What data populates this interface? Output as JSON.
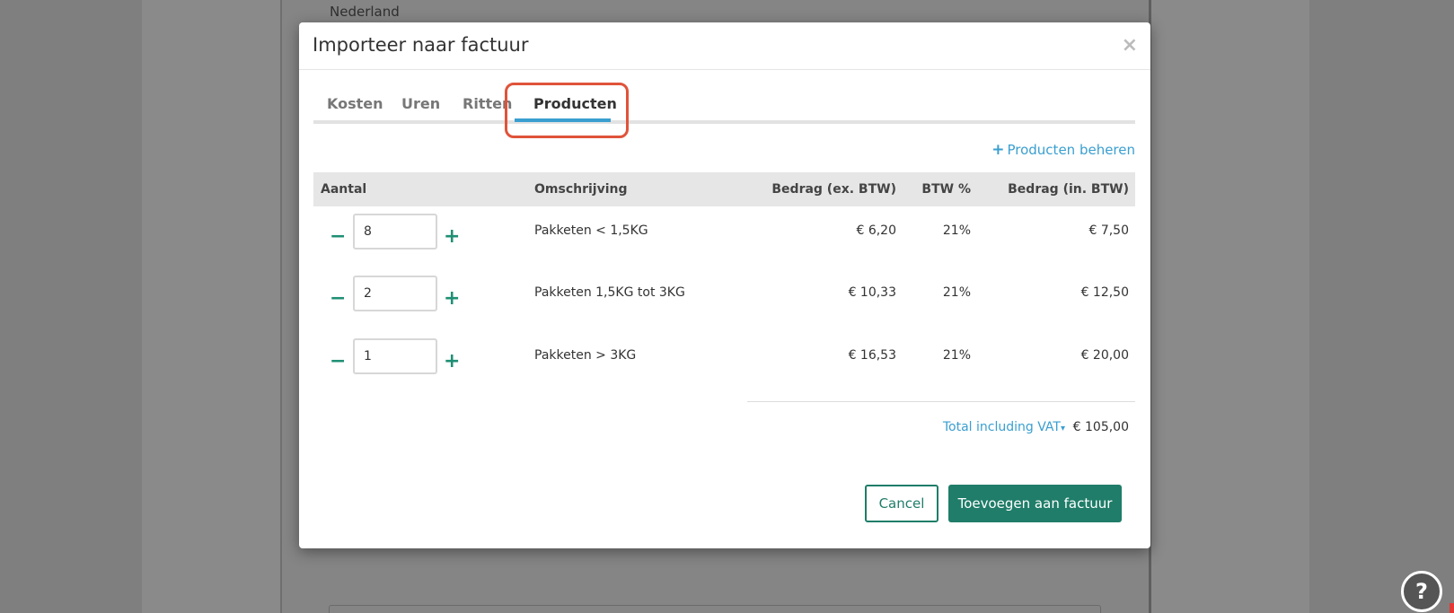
{
  "background": {
    "country": "Nederland",
    "help_label": "?"
  },
  "modal": {
    "title": "Importeer naar factuur",
    "close_label": "×",
    "tabs": [
      {
        "label": "Kosten"
      },
      {
        "label": "Uren"
      },
      {
        "label": "Ritten"
      },
      {
        "label": "Producten"
      }
    ],
    "active_tab": "Producten",
    "manage_link": {
      "plus": "+",
      "label": "Producten beheren"
    },
    "table": {
      "headers": {
        "quantity": "Aantal",
        "description": "Omschrijving",
        "amount_ex": "Bedrag (ex. BTW)",
        "vat": "BTW %",
        "amount_in": "Bedrag (in. BTW)"
      },
      "rows": [
        {
          "qty": "8",
          "description": "Pakketen < 1,5KG",
          "amount_ex": "€ 6,20",
          "vat": "21%",
          "amount_in": "€ 7,50"
        },
        {
          "qty": "2",
          "description": "Pakketen 1,5KG tot 3KG",
          "amount_ex": "€ 10,33",
          "vat": "21%",
          "amount_in": "€ 12,50"
        },
        {
          "qty": "1",
          "description": "Pakketen > 3KG",
          "amount_ex": "€ 16,53",
          "vat": "21%",
          "amount_in": "€ 20,00"
        }
      ],
      "stepper": {
        "minus": "−",
        "plus": "+"
      }
    },
    "total": {
      "label": "Total including VAT",
      "caret": "▾",
      "value": "€ 105,00"
    },
    "buttons": {
      "cancel": "Cancel",
      "add": "Toevoegen aan factuur"
    }
  },
  "colors": {
    "accent": "#3a9fd0",
    "primary": "#1f7d69",
    "highlight": "#e0533a"
  }
}
